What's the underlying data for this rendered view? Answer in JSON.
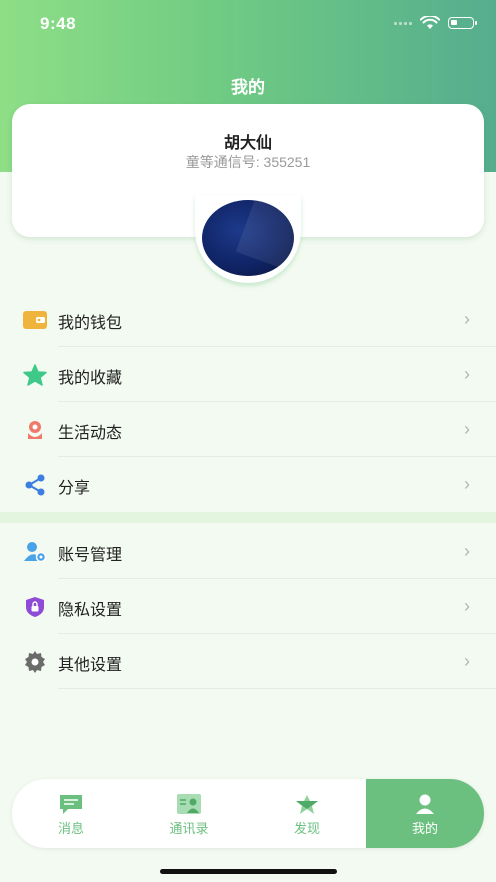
{
  "status_bar": {
    "time": "9:48"
  },
  "header": {
    "title": "我的"
  },
  "profile": {
    "name": "胡大仙",
    "id_label": "童等通信号: 355251"
  },
  "menu_group1": [
    {
      "label": "我的钱包",
      "icon": "wallet-icon"
    },
    {
      "label": "我的收藏",
      "icon": "star-icon"
    },
    {
      "label": "生活动态",
      "icon": "flower-icon"
    },
    {
      "label": "分享",
      "icon": "share-icon"
    }
  ],
  "menu_group2": [
    {
      "label": "账号管理",
      "icon": "account-manage-icon"
    },
    {
      "label": "隐私设置",
      "icon": "privacy-lock-icon"
    },
    {
      "label": "其他设置",
      "icon": "gear-icon"
    }
  ],
  "tabbar": {
    "tabs": [
      {
        "label": "消息",
        "icon": "message-icon"
      },
      {
        "label": "通讯录",
        "icon": "contacts-icon"
      },
      {
        "label": "发现",
        "icon": "discover-icon"
      },
      {
        "label": "我的",
        "icon": "profile-icon",
        "active": true
      }
    ]
  },
  "colors": {
    "accent": "#6cc07f",
    "header_start": "#8ede86",
    "header_end": "#55ad8e"
  }
}
